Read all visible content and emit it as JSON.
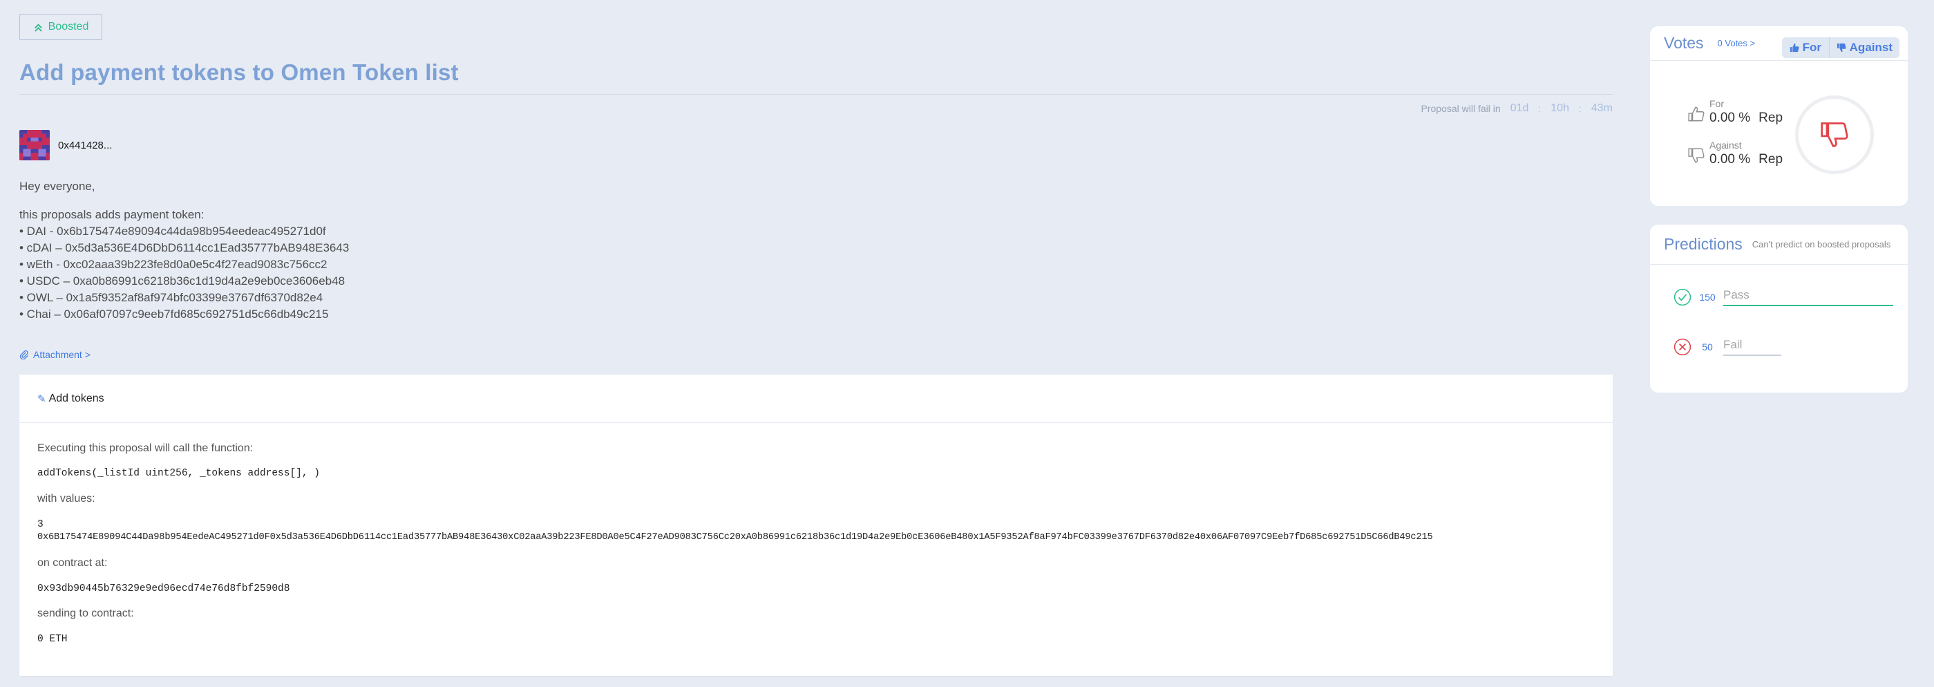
{
  "proposal": {
    "boosted_label": "Boosted",
    "title": "Add payment tokens to Omen Token list",
    "countdown": {
      "label": "Proposal will fail in",
      "days": "01d",
      "sep1": ":",
      "hours": "10h",
      "sep2": ":",
      "minutes": "43m"
    },
    "author": "0x441428...",
    "body": {
      "greeting": "Hey everyone,",
      "intro": "this proposals adds payment token:",
      "tokens": [
        "• DAI - 0x6b175474e89094c44da98b954eedeac495271d0f",
        "• cDAI – 0x5d3a536E4D6DbD6114cc1Ead35777bAB948E3643",
        "• wEth - 0xc02aaa39b223fe8d0a0e5c4f27ead9083c756cc2",
        "• USDC – 0xa0b86991c6218b36c1d19d4a2e9eb0ce3606eb48",
        "• OWL – 0x1a5f9352af8af974bfc03399e3767df6370d82e4",
        "• Chai – 0x06af07097c9eeb7fd685c692751d5c66db49c215"
      ]
    },
    "attachment_label": "Attachment >",
    "action": {
      "title": "Add tokens",
      "executing_label": "Executing this proposal will call the function:",
      "function_sig": "addTokens(_listId uint256, _tokens address[], )",
      "with_values_label": "with values:",
      "value_list_id": "3",
      "value_tokens": "0x6B175474E89094C44Da98b954EedeAC495271d0F0x5d3a536E4D6DbD6114cc1Ead35777bAB948E36430xC02aaA39b223FE8D0A0e5C4F27eAD9083C756Cc20xA0b86991c6218b36c1d19D4a2e9Eb0cE3606eB480x1A5F9352Af8aF974bFC03399e3767DF6370d82e40x06AF07097C9Eeb7fD685c692751D5C66dB49c215",
      "on_contract_label": "on contract at:",
      "contract_address": "0x93db90445b76329e9ed96ecd74e76d8fbf2590d8",
      "sending_label": "sending to contract:",
      "sending_value": "0 ETH"
    }
  },
  "votes": {
    "title": "Votes",
    "count_label": "0 Votes >",
    "for_button": "For",
    "against_button": "Against",
    "for_label": "For",
    "for_percent": "0.00 %",
    "for_unit": "Rep",
    "against_label": "Against",
    "against_percent": "0.00 %",
    "against_unit": "Rep"
  },
  "predictions": {
    "title": "Predictions",
    "note": "Can't predict on boosted proposals",
    "pass_count": "150",
    "pass_placeholder": "Pass",
    "fail_count": "50",
    "fail_placeholder": "Fail"
  },
  "colors": {
    "background": "#e6ebf4",
    "title": "#7ea1d6",
    "accent_blue": "#4a7ee0",
    "pass_green": "#2ebd8c",
    "fail_red": "#e0454b"
  }
}
